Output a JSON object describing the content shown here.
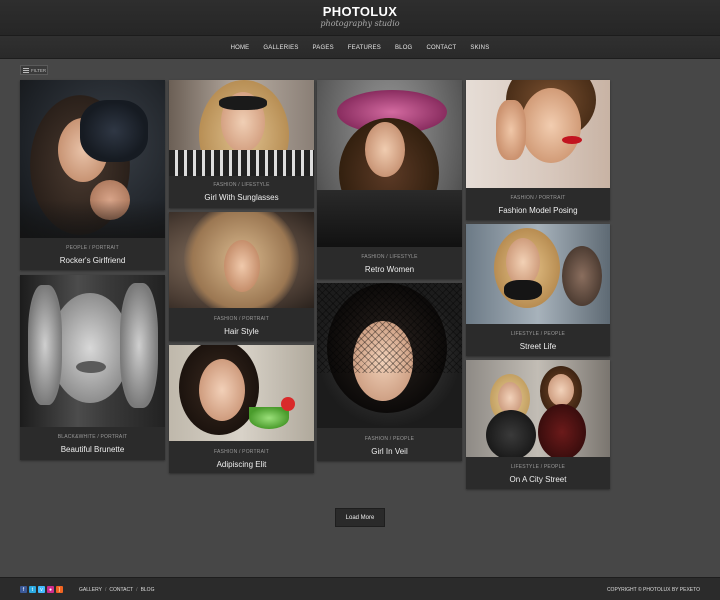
{
  "site": {
    "logo_title": "PHOTOLUX",
    "logo_tagline": "photography studio"
  },
  "nav": {
    "items": [
      "HOME",
      "GALLERIES",
      "PAGES",
      "FEATURES",
      "BLOG",
      "CONTACT",
      "SKINS"
    ]
  },
  "filter": {
    "label": "FILTER",
    "icon": "list-icon"
  },
  "gallery": {
    "items": [
      {
        "title": "Rocker's Girlfriend",
        "category": "PEOPLE / PORTRAIT"
      },
      {
        "title": "Beautiful Brunette",
        "category": "BLACK&WHITE / PORTRAIT"
      },
      {
        "title": "Girl With Sunglasses",
        "category": "FASHION / LIFESTYLE"
      },
      {
        "title": "Hair Style",
        "category": "FASHION / PORTRAIT"
      },
      {
        "title": "Adipiscing Elit",
        "category": "FASHION / PORTRAIT"
      },
      {
        "title": "Retro Women",
        "category": "FASHION / LIFESTYLE"
      },
      {
        "title": "Girl In Veil",
        "category": "FASHION / PEOPLE"
      },
      {
        "title": "Fashion Model Posing",
        "category": "FASHION / PORTRAIT"
      },
      {
        "title": "Street Life",
        "category": "LIFESTYLE / PEOPLE"
      },
      {
        "title": "On A City Street",
        "category": "LIFESTYLE / PEOPLE"
      }
    ]
  },
  "load_more": {
    "label": "Load More"
  },
  "footer": {
    "social": [
      "facebook-icon",
      "twitter-icon",
      "vimeo-icon",
      "flickr-icon",
      "rss-icon"
    ],
    "social_glyphs": [
      "f",
      "t",
      "v",
      "●",
      ")"
    ],
    "social_colors": [
      "#3b5998",
      "#2ba9e1",
      "#44bbff",
      "#d02c8e",
      "#f26522"
    ],
    "links": [
      "GALLERY",
      "CONTACT",
      "BLOG"
    ],
    "copyright": "COPYRIGHT © PHOTOLUX BY PEXETO"
  }
}
